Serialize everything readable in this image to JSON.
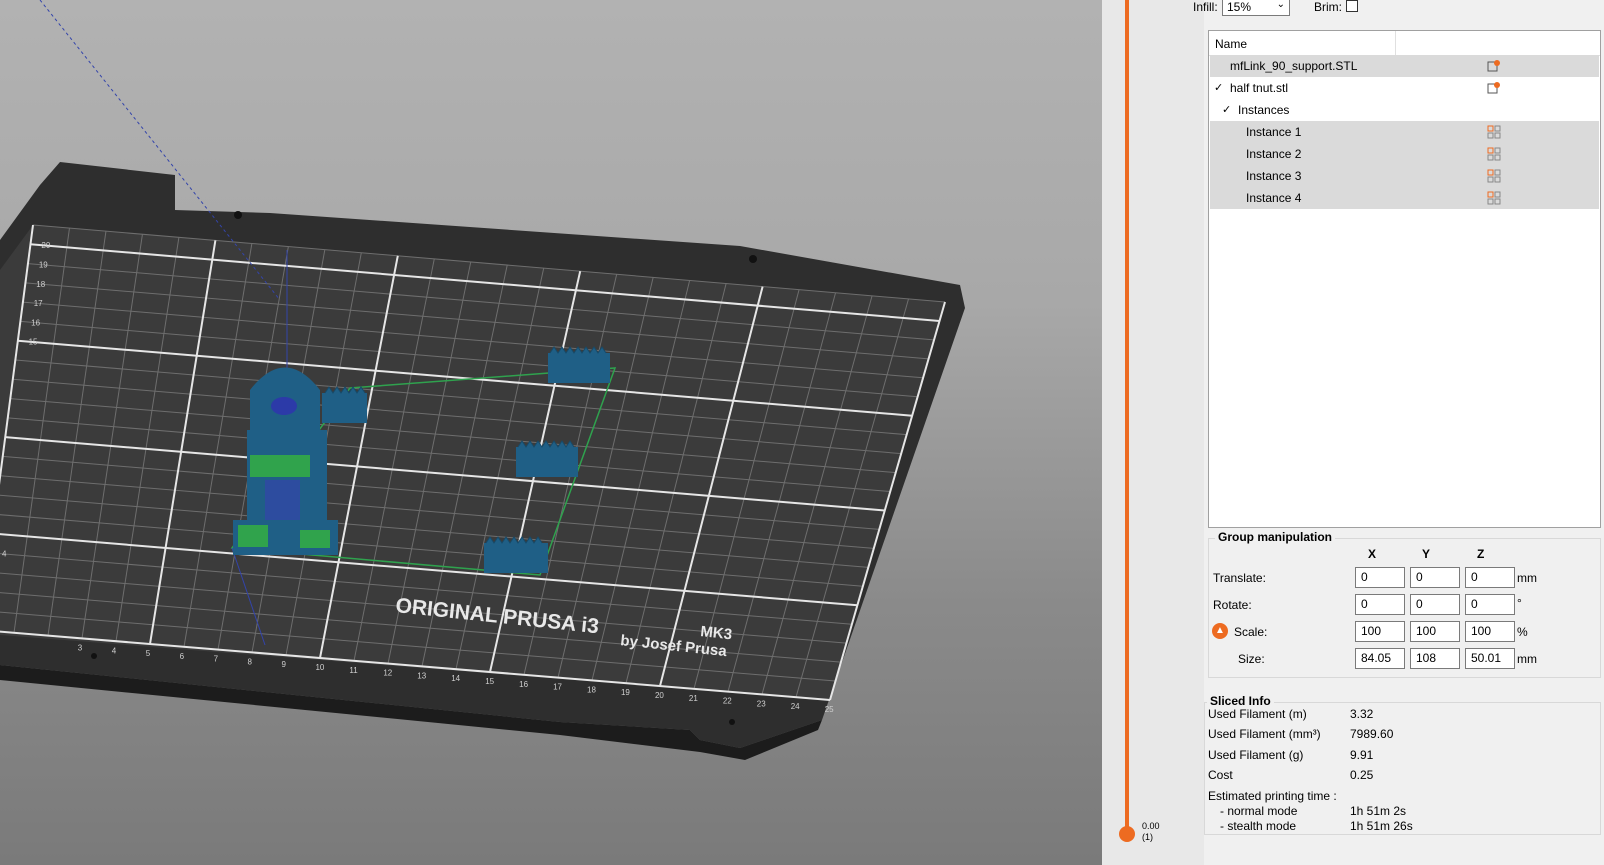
{
  "top_settings": {
    "infill_label": "Infill:",
    "infill_value": "15%",
    "brim_label": "Brim:"
  },
  "object_list": {
    "header_name": "Name",
    "items": [
      {
        "label": "mfLink_90_support.STL",
        "icon": "edit-settings-icon"
      },
      {
        "label": "half tnut.stl",
        "icon": "edit-settings-icon",
        "expanded": true
      },
      {
        "label": "Instances",
        "expanded": true
      },
      {
        "label": "Instance 1",
        "icon": "instance-icon"
      },
      {
        "label": "Instance 2",
        "icon": "instance-icon"
      },
      {
        "label": "Instance 3",
        "icon": "instance-icon"
      },
      {
        "label": "Instance 4",
        "icon": "instance-icon"
      }
    ]
  },
  "group_manipulation": {
    "title": "Group manipulation",
    "axes": [
      "X",
      "Y",
      "Z"
    ],
    "rows": [
      {
        "label": "Translate:",
        "values": [
          "0",
          "0",
          "0"
        ],
        "unit": "mm"
      },
      {
        "label": "Rotate:",
        "values": [
          "0",
          "0",
          "0"
        ],
        "unit": "°"
      },
      {
        "label": "Scale:",
        "values": [
          "100",
          "100",
          "100"
        ],
        "unit": "%"
      },
      {
        "label": "Size:",
        "values": [
          "84.05",
          "108",
          "50.01"
        ],
        "unit": "mm"
      }
    ]
  },
  "sliced_info": {
    "title": "Sliced Info",
    "rows": [
      {
        "label": "Used Filament (m)",
        "value": "3.32"
      },
      {
        "label": "Used Filament (mm³)",
        "value": "7989.60"
      },
      {
        "label": "Used Filament (g)",
        "value": "9.91"
      },
      {
        "label": "Cost",
        "value": "0.25"
      }
    ],
    "time_title": "Estimated printing time :",
    "time_rows": [
      {
        "label": "- normal mode",
        "value": "1h 51m 2s"
      },
      {
        "label": "- stealth mode",
        "value": "1h 51m 26s"
      }
    ]
  },
  "layer_slider": {
    "value": "0.00",
    "layer": "(1)"
  },
  "bed": {
    "brand": "ORIGINAL PRUSA i3",
    "model": "MK3",
    "byline": "by Josef Prusa",
    "x_ticks": [
      "3",
      "4",
      "5",
      "6",
      "7",
      "8",
      "9",
      "10",
      "11",
      "12",
      "13",
      "14",
      "15",
      "16",
      "17",
      "18",
      "19",
      "20",
      "21",
      "22",
      "23",
      "24",
      "25"
    ],
    "y_ticks": [
      "20",
      "19",
      "18",
      "17",
      "16",
      "15",
      "4"
    ]
  },
  "colors": {
    "accent": "#ed6b21",
    "part": "#1f5f86",
    "support": "#3cc83c",
    "bed": "#2f2f2f"
  }
}
